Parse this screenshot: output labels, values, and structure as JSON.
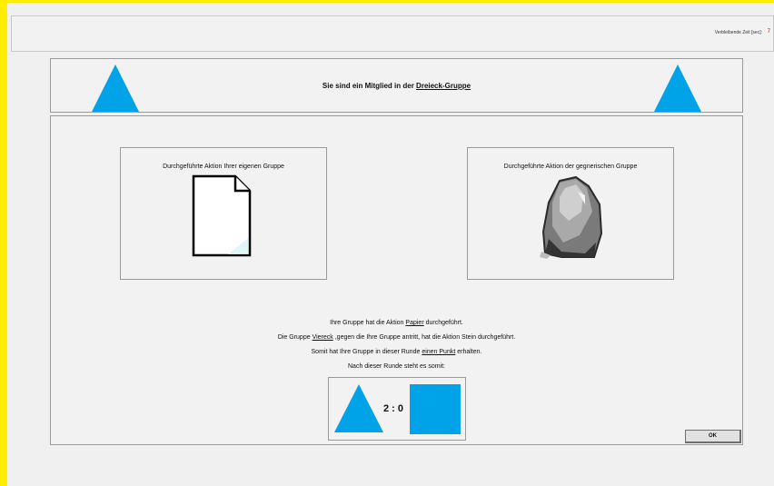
{
  "header": {
    "timer_label": "Verbleibende Zeit [sec]:",
    "timer_value": "7"
  },
  "banner": {
    "text_prefix": "Sie sind ein Mitglied in der ",
    "group_name": "Dreieck-Gruppe"
  },
  "own_group": {
    "title": "Durchgeführte Aktion Ihrer eigenen Gruppe",
    "action_icon": "paper-icon"
  },
  "opponent_group": {
    "title": "Durchgeführte Aktion der gegnerischen Gruppe",
    "action_icon": "rock-icon"
  },
  "result": {
    "line1_prefix": "Ihre Gruppe hat die Aktion ",
    "line1_action": "Papier",
    "line1_suffix": " durchgeführt.",
    "line2_prefix": "Die Gruppe ",
    "line2_group": "Viereck",
    "line2_suffix": " ,gegen die Ihre Gruppe antritt, hat die Aktion Stein durchgeführt.",
    "line3_prefix": "Somit hat Ihre Gruppe in dieser Runde ",
    "line3_points": "einen Punkt",
    "line3_suffix": " erhalten.",
    "line4": "Nach dieser Runde steht es somit:"
  },
  "score": {
    "text": "2 : 0",
    "own_shape": "triangle",
    "opponent_shape": "square"
  },
  "ok_button": {
    "label": "OK"
  },
  "colors": {
    "accent_blue": "#00a2e8",
    "frame_yellow": "#ffee00",
    "timer_red": "#e00000"
  }
}
